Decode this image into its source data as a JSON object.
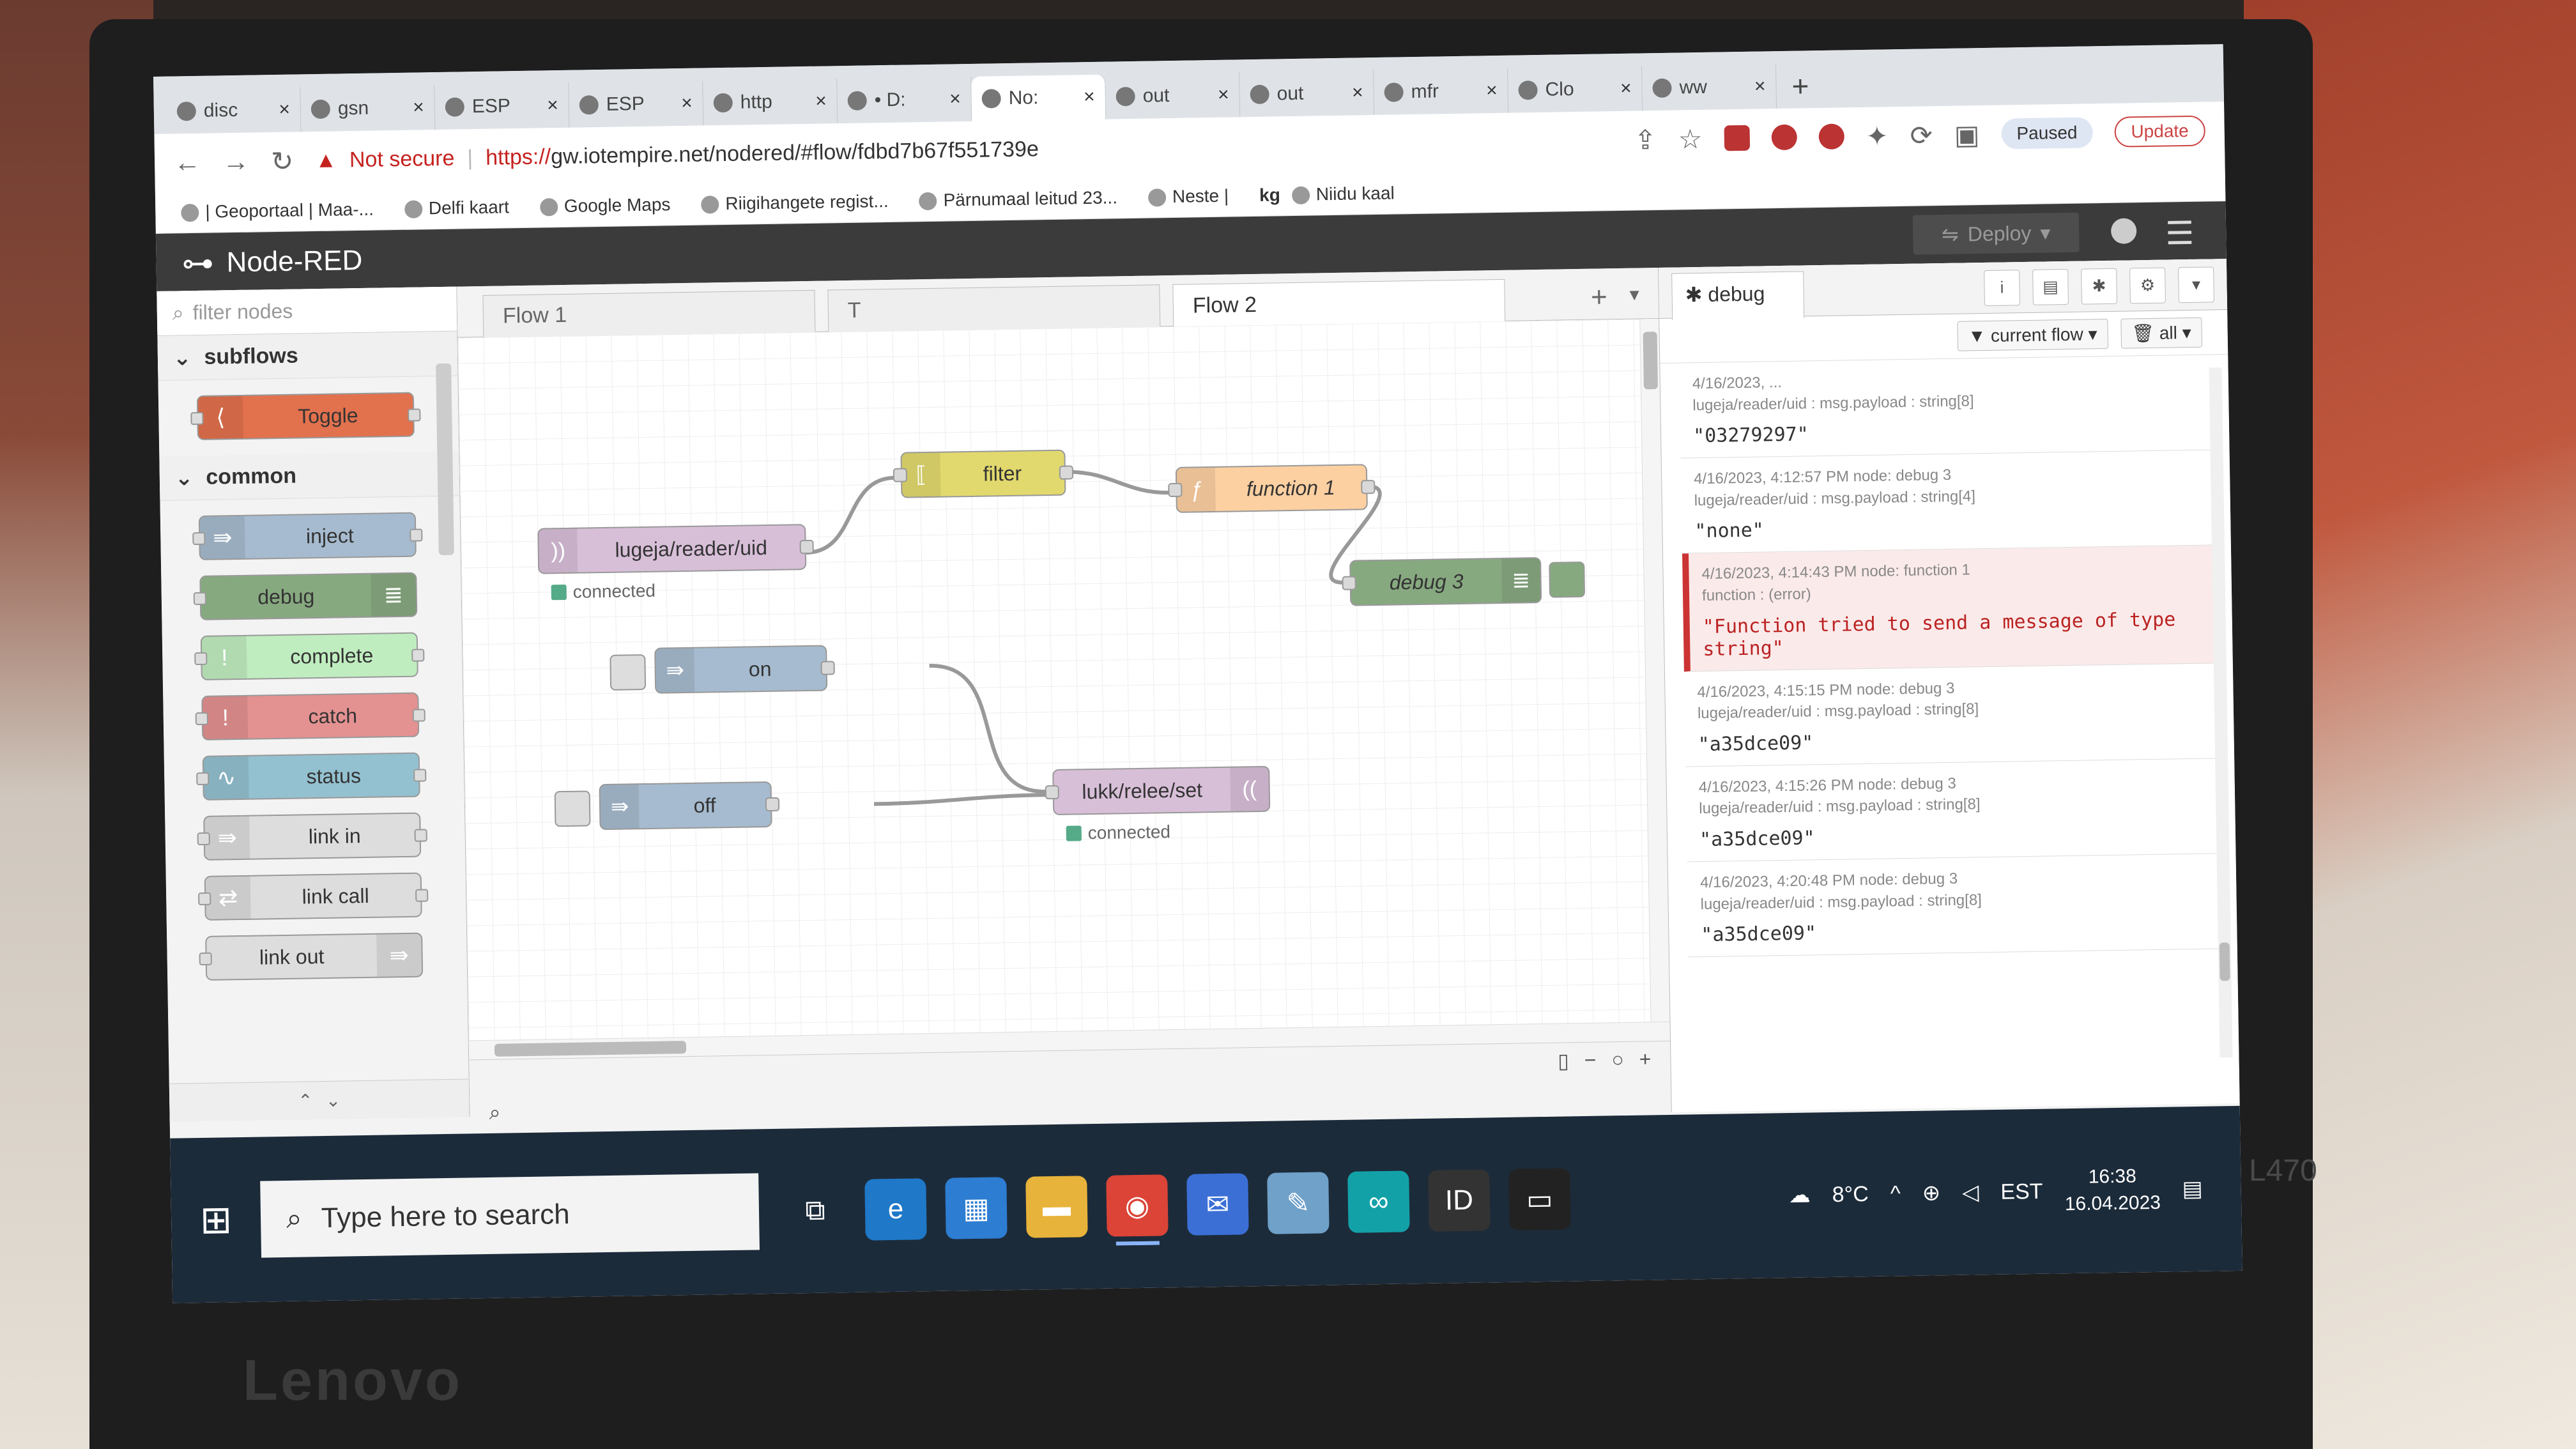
{
  "browser": {
    "tabs": [
      {
        "label": "disc",
        "active": false
      },
      {
        "label": "gsn",
        "active": false
      },
      {
        "label": "ESP",
        "active": false
      },
      {
        "label": "ESP",
        "active": false
      },
      {
        "label": "http",
        "active": false
      },
      {
        "label": "• D:",
        "active": false
      },
      {
        "label": "No:",
        "active": true
      },
      {
        "label": "out",
        "active": false
      },
      {
        "label": "out",
        "active": false
      },
      {
        "label": "mfr",
        "active": false
      },
      {
        "label": "Clo",
        "active": false
      },
      {
        "label": "ww",
        "active": false
      }
    ],
    "new_tab": "+",
    "not_secure": "Not secure",
    "url_scheme": "https://",
    "url_rest": "gw.iotempire.net/nodered/#flow/fdbd7b67f551739e",
    "profile_status": "Paused",
    "update_label": "Update",
    "bookmarks": [
      "| Geoportaal | Maa-...",
      "Delfi kaart",
      "Google Maps",
      "Riigihangete regist...",
      "Pärnumaal leitud 23...",
      "Neste |",
      "Niidu kaal"
    ],
    "bookmark_kg": "kg"
  },
  "nodered": {
    "app_title": "Node-RED",
    "deploy_label": "Deploy",
    "palette": {
      "filter_placeholder": "filter nodes",
      "categories": [
        {
          "name": "subflows",
          "nodes": [
            {
              "label": "Toggle",
              "color": "#e2714e"
            }
          ]
        },
        {
          "name": "common",
          "nodes": [
            {
              "label": "inject",
              "color": "#a6bbcf"
            },
            {
              "label": "debug",
              "color": "#87a980"
            },
            {
              "label": "complete",
              "color": "#c0edc0"
            },
            {
              "label": "catch",
              "color": "#e49191"
            },
            {
              "label": "status",
              "color": "#94c1d0"
            },
            {
              "label": "link in",
              "color": "#dddddd"
            },
            {
              "label": "link call",
              "color": "#dddddd"
            },
            {
              "label": "link out",
              "color": "#dddddd"
            }
          ]
        }
      ]
    },
    "workspace_tabs": [
      {
        "label": "Flow 1",
        "active": false
      },
      {
        "label": "T",
        "active": false
      },
      {
        "label": "Flow 2",
        "active": true
      }
    ],
    "flow_nodes": {
      "mqtt_in": {
        "label": "lugeja/reader/uid",
        "status": "connected",
        "color": "#d8bfd8"
      },
      "filter": {
        "label": "filter",
        "color": "#e2d96e"
      },
      "function1": {
        "label": "function 1",
        "color": "#fdd0a2"
      },
      "debug3": {
        "label": "debug 3",
        "color": "#87a980"
      },
      "inject_on": {
        "label": "on",
        "color": "#a6bbcf"
      },
      "inject_off": {
        "label": "off",
        "color": "#a6bbcf"
      },
      "mqtt_out": {
        "label": "lukk/relee/set",
        "status": "connected",
        "color": "#d8bfd8"
      }
    },
    "debug_sidebar": {
      "tab_label": "debug",
      "filter_label": "current flow",
      "clear_label": "all",
      "messages": [
        {
          "meta1": "4/16/2023, ...",
          "meta2": "lugeja/reader/uid : msg.payload : string[8]",
          "payload": "\"03279297\"",
          "error": false
        },
        {
          "meta1": "4/16/2023, 4:12:57 PM   node: debug 3",
          "meta2": "lugeja/reader/uid : msg.payload : string[4]",
          "payload": "\"none\"",
          "error": false
        },
        {
          "meta1": "4/16/2023, 4:14:43 PM   node: function 1",
          "meta2": "function : (error)",
          "payload": "\"Function tried to send a message of type string\"",
          "error": true
        },
        {
          "meta1": "4/16/2023, 4:15:15 PM   node: debug 3",
          "meta2": "lugeja/reader/uid : msg.payload : string[8]",
          "payload": "\"a35dce09\"",
          "error": false
        },
        {
          "meta1": "4/16/2023, 4:15:26 PM   node: debug 3",
          "meta2": "lugeja/reader/uid : msg.payload : string[8]",
          "payload": "\"a35dce09\"",
          "error": false
        },
        {
          "meta1": "4/16/2023, 4:20:48 PM   node: debug 3",
          "meta2": "lugeja/reader/uid : msg.payload : string[8]",
          "payload": "\"a35dce09\"",
          "error": false
        }
      ]
    }
  },
  "taskbar": {
    "search_placeholder": "Type here to search",
    "weather": "8°C",
    "locale": "EST",
    "time": "16:38",
    "date": "16.04.2023"
  },
  "device": {
    "brand": "Lenovo",
    "model": "L470"
  }
}
